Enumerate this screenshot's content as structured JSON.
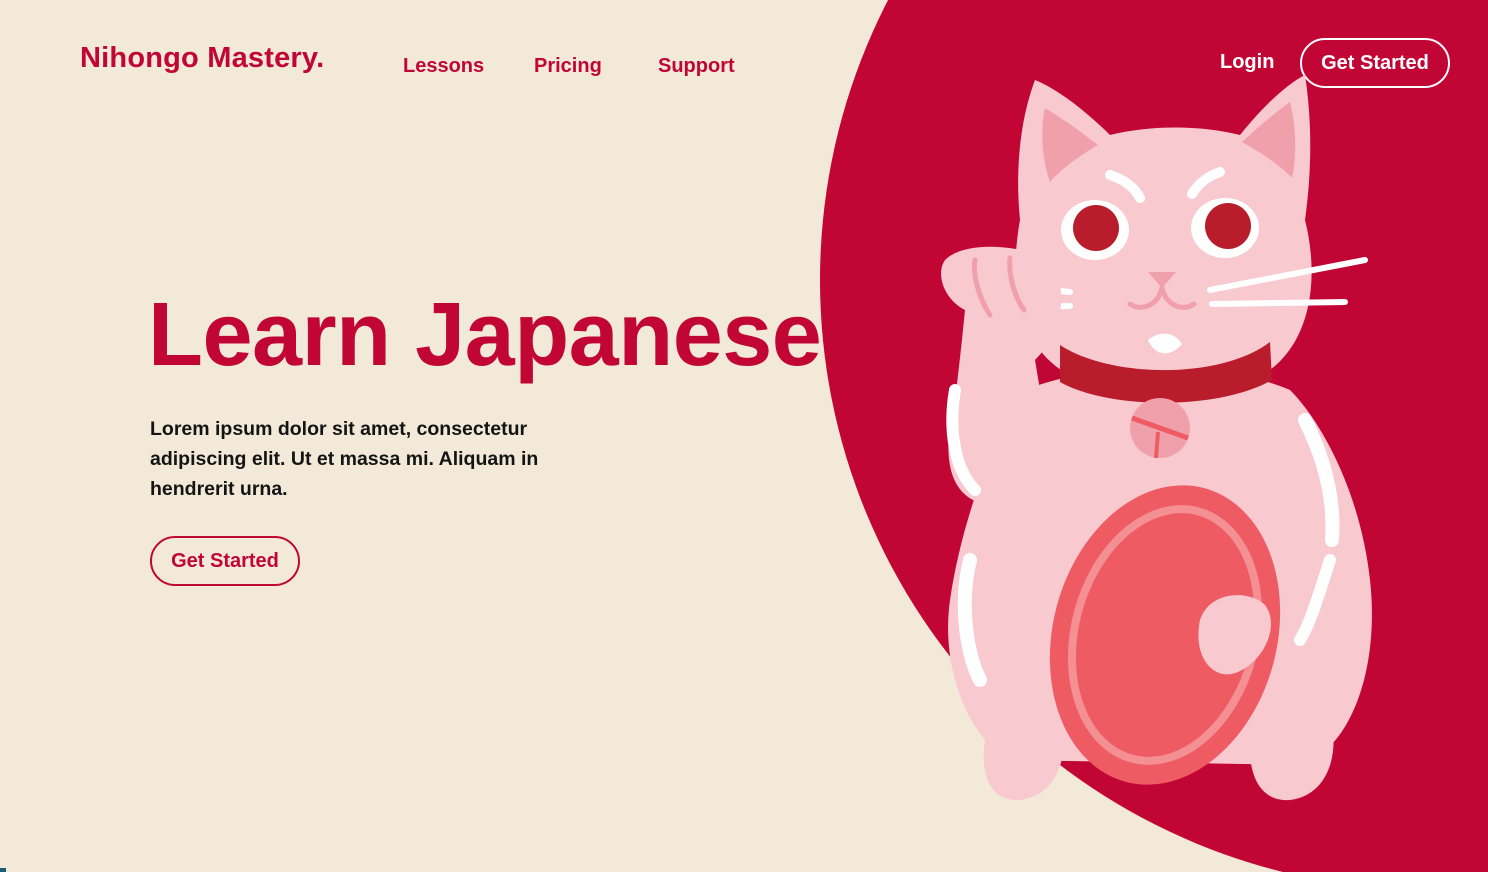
{
  "brand": {
    "logo": "Nihongo Mastery."
  },
  "nav": {
    "items": [
      {
        "label": "Lessons"
      },
      {
        "label": "Pricing"
      },
      {
        "label": "Support"
      }
    ],
    "login_label": "Login",
    "cta_label": "Get Started"
  },
  "hero": {
    "title": "Learn Japanese",
    "body": "Lorem ipsum dolor sit amet, consectetur adipiscing elit. Ut et massa mi. Aliquam in hendrerit urna.",
    "cta_label": "Get Started"
  },
  "illustration": {
    "subject": "maneki-neko-icon"
  },
  "colors": {
    "background": "#f3e9d9",
    "accent": "#c10534",
    "cat_body": "#f9c9d0",
    "cat_shadow": "#f0a0ab",
    "cat_collar": "#b91c2a",
    "coin": "#ee5b62"
  }
}
